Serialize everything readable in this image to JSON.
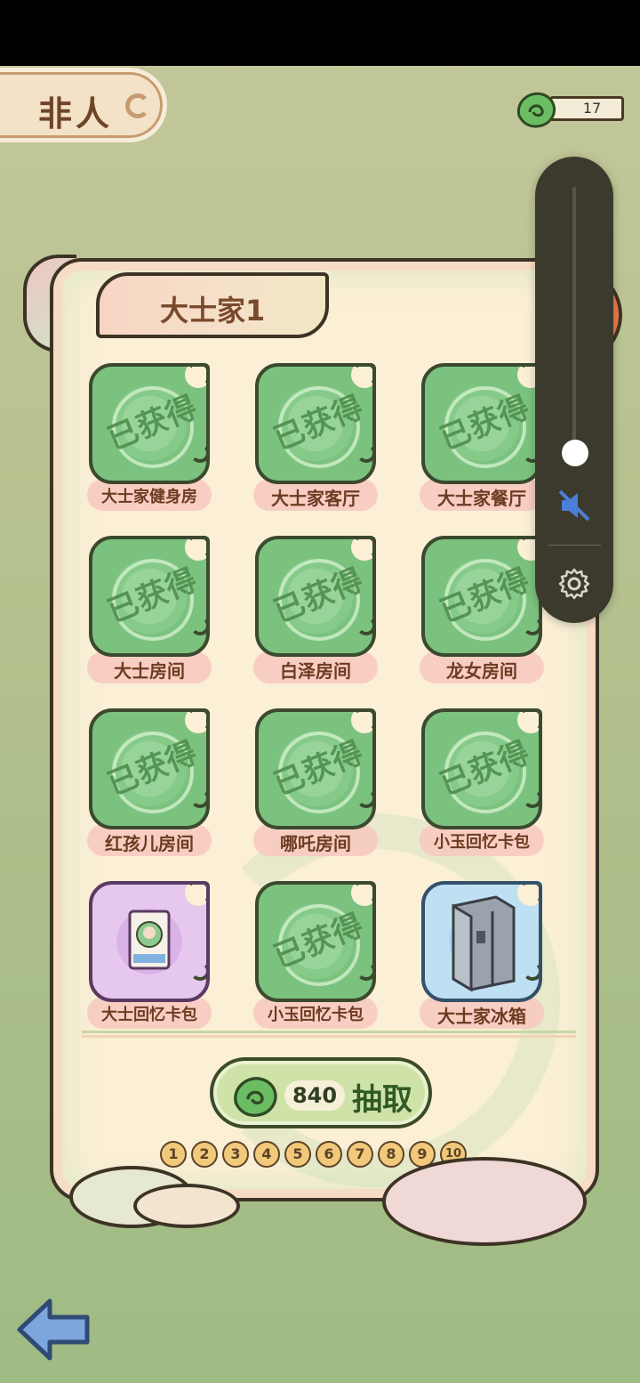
{
  "page": {
    "title": "非人",
    "coins": "17"
  },
  "section": {
    "title": "大士家1"
  },
  "stamp_text": "已获得",
  "cards": [
    {
      "label": "大士家健身房",
      "status": "owned",
      "color": "green"
    },
    {
      "label": "大士家客厅",
      "status": "owned",
      "color": "green"
    },
    {
      "label": "大士家餐厅",
      "status": "owned",
      "color": "green"
    },
    {
      "label": "大士房间",
      "status": "owned",
      "color": "green"
    },
    {
      "label": "白泽房间",
      "status": "owned",
      "color": "green"
    },
    {
      "label": "龙女房间",
      "status": "owned",
      "color": "green"
    },
    {
      "label": "红孩儿房间",
      "status": "owned",
      "color": "green"
    },
    {
      "label": "哪吒房间",
      "status": "owned",
      "color": "green"
    },
    {
      "label": "小玉回忆卡包",
      "status": "owned",
      "color": "green"
    },
    {
      "label": "大士回忆卡包",
      "status": "item",
      "color": "purple",
      "icon": "card-pack-icon"
    },
    {
      "label": "小玉回忆卡包",
      "status": "owned",
      "color": "green"
    },
    {
      "label": "大士家冰箱",
      "status": "item",
      "color": "blue",
      "icon": "fridge-icon"
    }
  ],
  "draw": {
    "cost": "840",
    "label": "抽取"
  },
  "pager": [
    "1",
    "2",
    "3",
    "4",
    "5",
    "6",
    "7",
    "8",
    "9",
    "10"
  ],
  "colors": {
    "panel_bg": "#fbefd6",
    "tile_green": "#7fc581",
    "tile_purple": "#d9b2e6",
    "tile_blue": "#a9d4ec",
    "text_brown": "#6c3b22",
    "volume_bg": "#3b3a2d",
    "mute_blue": "#4a7fd8"
  }
}
